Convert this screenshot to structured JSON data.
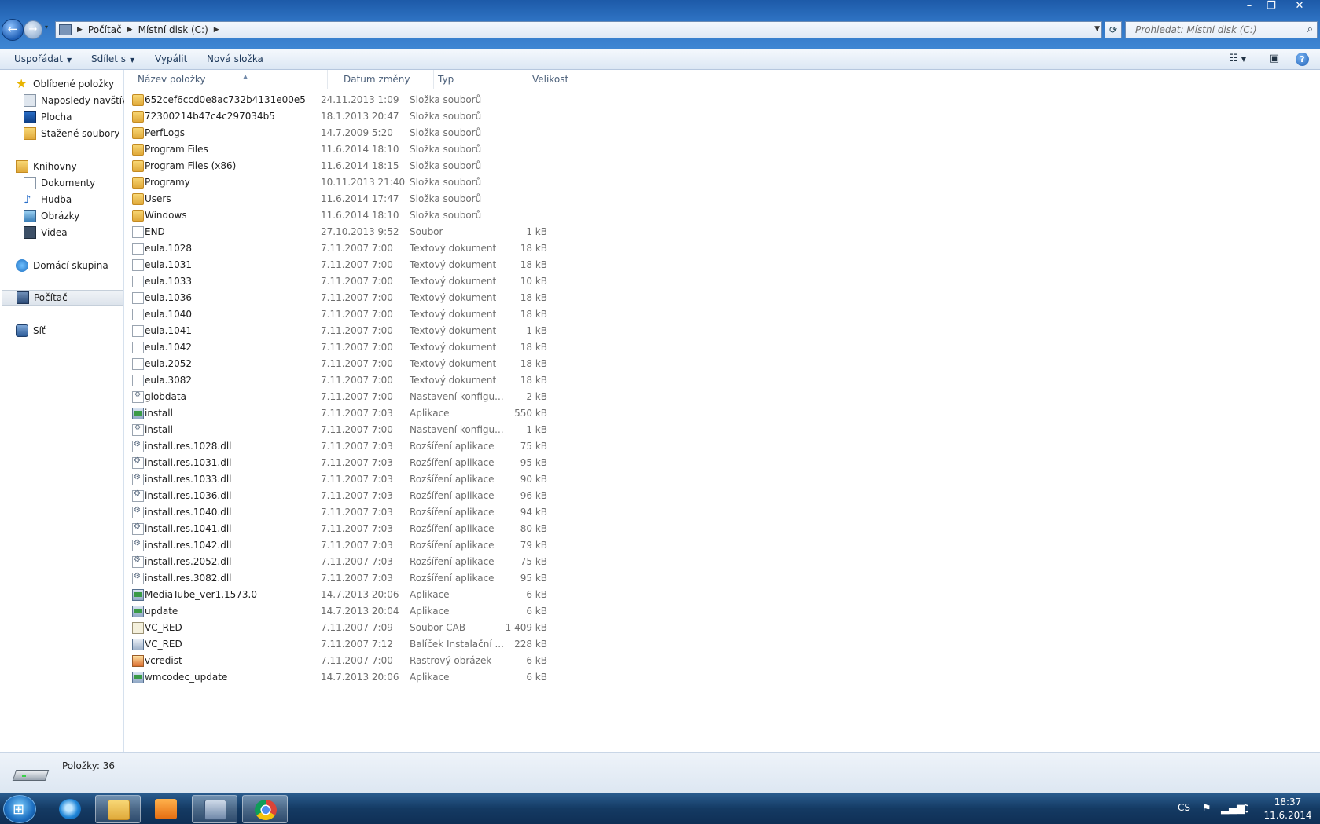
{
  "window": {
    "minimize": "–",
    "maximize": "❐",
    "close": "✕"
  },
  "nav": {
    "back": "←",
    "forward": "→",
    "history": "▾"
  },
  "address": {
    "crumbs": [
      "Počítač",
      "Místní disk (C:)"
    ]
  },
  "search": {
    "placeholder": "Prohledat: Místní disk (C:)"
  },
  "toolbar": {
    "organize": "Uspořádat",
    "share": "Sdílet s",
    "burn": "Vypálit",
    "new_folder": "Nová složka"
  },
  "sidebar": {
    "favorites": "Oblíbené položky",
    "recent": "Naposledy navštíven",
    "desktop": "Plocha",
    "downloads": "Stažené soubory",
    "libraries": "Knihovny",
    "documents": "Dokumenty",
    "music": "Hudba",
    "pictures": "Obrázky",
    "videos": "Videa",
    "homegroup": "Domácí skupina",
    "computer": "Počítač",
    "network": "Síť"
  },
  "columns": {
    "name": "Název položky",
    "date": "Datum změny",
    "type": "Typ",
    "size": "Velikost"
  },
  "files": [
    {
      "name": "652cef6ccd0e8ac732b4131e00e5",
      "date": "24.11.2013 1:09",
      "type": "Složka souborů",
      "size": "",
      "icon": "folder"
    },
    {
      "name": "72300214b47c4c297034b5",
      "date": "18.1.2013 20:47",
      "type": "Složka souborů",
      "size": "",
      "icon": "folder"
    },
    {
      "name": "PerfLogs",
      "date": "14.7.2009 5:20",
      "type": "Složka souborů",
      "size": "",
      "icon": "folder"
    },
    {
      "name": "Program Files",
      "date": "11.6.2014 18:10",
      "type": "Složka souborů",
      "size": "",
      "icon": "folder"
    },
    {
      "name": "Program Files (x86)",
      "date": "11.6.2014 18:15",
      "type": "Složka souborů",
      "size": "",
      "icon": "folder"
    },
    {
      "name": "Programy",
      "date": "10.11.2013 21:40",
      "type": "Složka souborů",
      "size": "",
      "icon": "folder"
    },
    {
      "name": "Users",
      "date": "11.6.2014 17:47",
      "type": "Složka souborů",
      "size": "",
      "icon": "folder"
    },
    {
      "name": "Windows",
      "date": "11.6.2014 18:10",
      "type": "Složka souborů",
      "size": "",
      "icon": "folder"
    },
    {
      "name": "END",
      "date": "27.10.2013 9:52",
      "type": "Soubor",
      "size": "1 kB",
      "icon": "file"
    },
    {
      "name": "eula.1028",
      "date": "7.11.2007 7:00",
      "type": "Textový dokument",
      "size": "18 kB",
      "icon": "file"
    },
    {
      "name": "eula.1031",
      "date": "7.11.2007 7:00",
      "type": "Textový dokument",
      "size": "18 kB",
      "icon": "file"
    },
    {
      "name": "eula.1033",
      "date": "7.11.2007 7:00",
      "type": "Textový dokument",
      "size": "10 kB",
      "icon": "file"
    },
    {
      "name": "eula.1036",
      "date": "7.11.2007 7:00",
      "type": "Textový dokument",
      "size": "18 kB",
      "icon": "file"
    },
    {
      "name": "eula.1040",
      "date": "7.11.2007 7:00",
      "type": "Textový dokument",
      "size": "18 kB",
      "icon": "file"
    },
    {
      "name": "eula.1041",
      "date": "7.11.2007 7:00",
      "type": "Textový dokument",
      "size": "1 kB",
      "icon": "file"
    },
    {
      "name": "eula.1042",
      "date": "7.11.2007 7:00",
      "type": "Textový dokument",
      "size": "18 kB",
      "icon": "file"
    },
    {
      "name": "eula.2052",
      "date": "7.11.2007 7:00",
      "type": "Textový dokument",
      "size": "18 kB",
      "icon": "file"
    },
    {
      "name": "eula.3082",
      "date": "7.11.2007 7:00",
      "type": "Textový dokument",
      "size": "18 kB",
      "icon": "file"
    },
    {
      "name": "globdata",
      "date": "7.11.2007 7:00",
      "type": "Nastavení konfigu...",
      "size": "2 kB",
      "icon": "cfg"
    },
    {
      "name": "install",
      "date": "7.11.2007 7:03",
      "type": "Aplikace",
      "size": "550 kB",
      "icon": "app"
    },
    {
      "name": "install",
      "date": "7.11.2007 7:00",
      "type": "Nastavení konfigu...",
      "size": "1 kB",
      "icon": "cfg"
    },
    {
      "name": "install.res.1028.dll",
      "date": "7.11.2007 7:03",
      "type": "Rozšíření aplikace",
      "size": "75 kB",
      "icon": "dll"
    },
    {
      "name": "install.res.1031.dll",
      "date": "7.11.2007 7:03",
      "type": "Rozšíření aplikace",
      "size": "95 kB",
      "icon": "dll"
    },
    {
      "name": "install.res.1033.dll",
      "date": "7.11.2007 7:03",
      "type": "Rozšíření aplikace",
      "size": "90 kB",
      "icon": "dll"
    },
    {
      "name": "install.res.1036.dll",
      "date": "7.11.2007 7:03",
      "type": "Rozšíření aplikace",
      "size": "96 kB",
      "icon": "dll"
    },
    {
      "name": "install.res.1040.dll",
      "date": "7.11.2007 7:03",
      "type": "Rozšíření aplikace",
      "size": "94 kB",
      "icon": "dll"
    },
    {
      "name": "install.res.1041.dll",
      "date": "7.11.2007 7:03",
      "type": "Rozšíření aplikace",
      "size": "80 kB",
      "icon": "dll"
    },
    {
      "name": "install.res.1042.dll",
      "date": "7.11.2007 7:03",
      "type": "Rozšíření aplikace",
      "size": "79 kB",
      "icon": "dll"
    },
    {
      "name": "install.res.2052.dll",
      "date": "7.11.2007 7:03",
      "type": "Rozšíření aplikace",
      "size": "75 kB",
      "icon": "dll"
    },
    {
      "name": "install.res.3082.dll",
      "date": "7.11.2007 7:03",
      "type": "Rozšíření aplikace",
      "size": "95 kB",
      "icon": "dll"
    },
    {
      "name": "MediaTube_ver1.1573.0",
      "date": "14.7.2013 20:06",
      "type": "Aplikace",
      "size": "6 kB",
      "icon": "app"
    },
    {
      "name": "update",
      "date": "14.7.2013 20:04",
      "type": "Aplikace",
      "size": "6 kB",
      "icon": "app"
    },
    {
      "name": "VC_RED",
      "date": "7.11.2007 7:09",
      "type": "Soubor CAB",
      "size": "1 409 kB",
      "icon": "cab"
    },
    {
      "name": "VC_RED",
      "date": "7.11.2007 7:12",
      "type": "Balíček Instalační ...",
      "size": "228 kB",
      "icon": "msi"
    },
    {
      "name": "vcredist",
      "date": "7.11.2007 7:00",
      "type": "Rastrový obrázek",
      "size": "6 kB",
      "icon": "img"
    },
    {
      "name": "wmcodec_update",
      "date": "14.7.2013 20:06",
      "type": "Aplikace",
      "size": "6 kB",
      "icon": "app"
    }
  ],
  "status": {
    "items_count": "Položky: 36"
  },
  "taskbar": {
    "language": "CS",
    "time": "18:37",
    "date": "11.6.2014"
  },
  "colors": {
    "titlebar": "#2f74c4",
    "command_text": "#1e395b",
    "secondary_text": "#6d6d6d"
  }
}
